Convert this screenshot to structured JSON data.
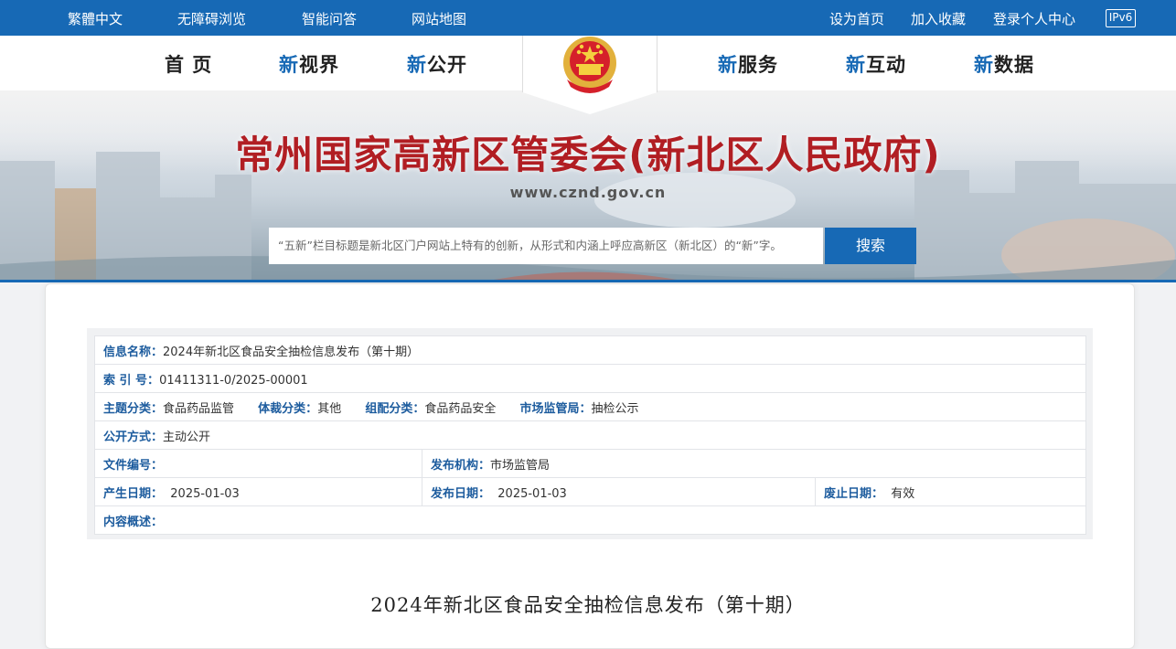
{
  "topbar": {
    "left_links": [
      "繁體中文",
      "无障碍浏览",
      "智能问答",
      "网站地图"
    ],
    "right_links": [
      "设为首页",
      "加入收藏",
      "登录个人中心"
    ],
    "ipv6": "IPv6"
  },
  "nav": {
    "home": "首 页",
    "items": [
      {
        "prefix": "新",
        "rest": "视界"
      },
      {
        "prefix": "新",
        "rest": "公开"
      },
      {
        "prefix": "新",
        "rest": "服务"
      },
      {
        "prefix": "新",
        "rest": "互动"
      },
      {
        "prefix": "新",
        "rest": "数据"
      }
    ]
  },
  "banner": {
    "title": "常州国家高新区管委会(新北区人民政府)",
    "url": "www.cznd.gov.cn"
  },
  "search": {
    "placeholder": "“五新”栏目标题是新北区门户网站上特有的创新，从形式和内涵上呼应高新区（新北区）的“新”字。",
    "button": "搜索"
  },
  "info": {
    "name_label": "信息名称：",
    "name_value": "2024年新北区食品安全抽检信息发布（第十期）",
    "index_label": "索 引 号：",
    "index_value": "01411311-0/2025-00001",
    "topic_label": "主题分类：",
    "topic_value": "食品药品监管",
    "genre_label": "体裁分类：",
    "genre_value": "其他",
    "group_label": "组配分类：",
    "group_value": "食品药品安全",
    "market_label": "市场监管局：",
    "market_value": "抽检公示",
    "open_label": "公开方式：",
    "open_value": "主动公开",
    "docno_label": "文件编号：",
    "docno_value": "",
    "org_label": "发布机构：",
    "org_value": "市场监管局",
    "created_label": "产生日期：",
    "created_value": "2025-01-03",
    "published_label": "发布日期：",
    "published_value": "2025-01-03",
    "expire_label": "废止日期：",
    "expire_value": "有效",
    "summary_label": "内容概述：",
    "summary_value": ""
  },
  "document": {
    "title": "2024年新北区食品安全抽检信息发布（第十期）"
  }
}
